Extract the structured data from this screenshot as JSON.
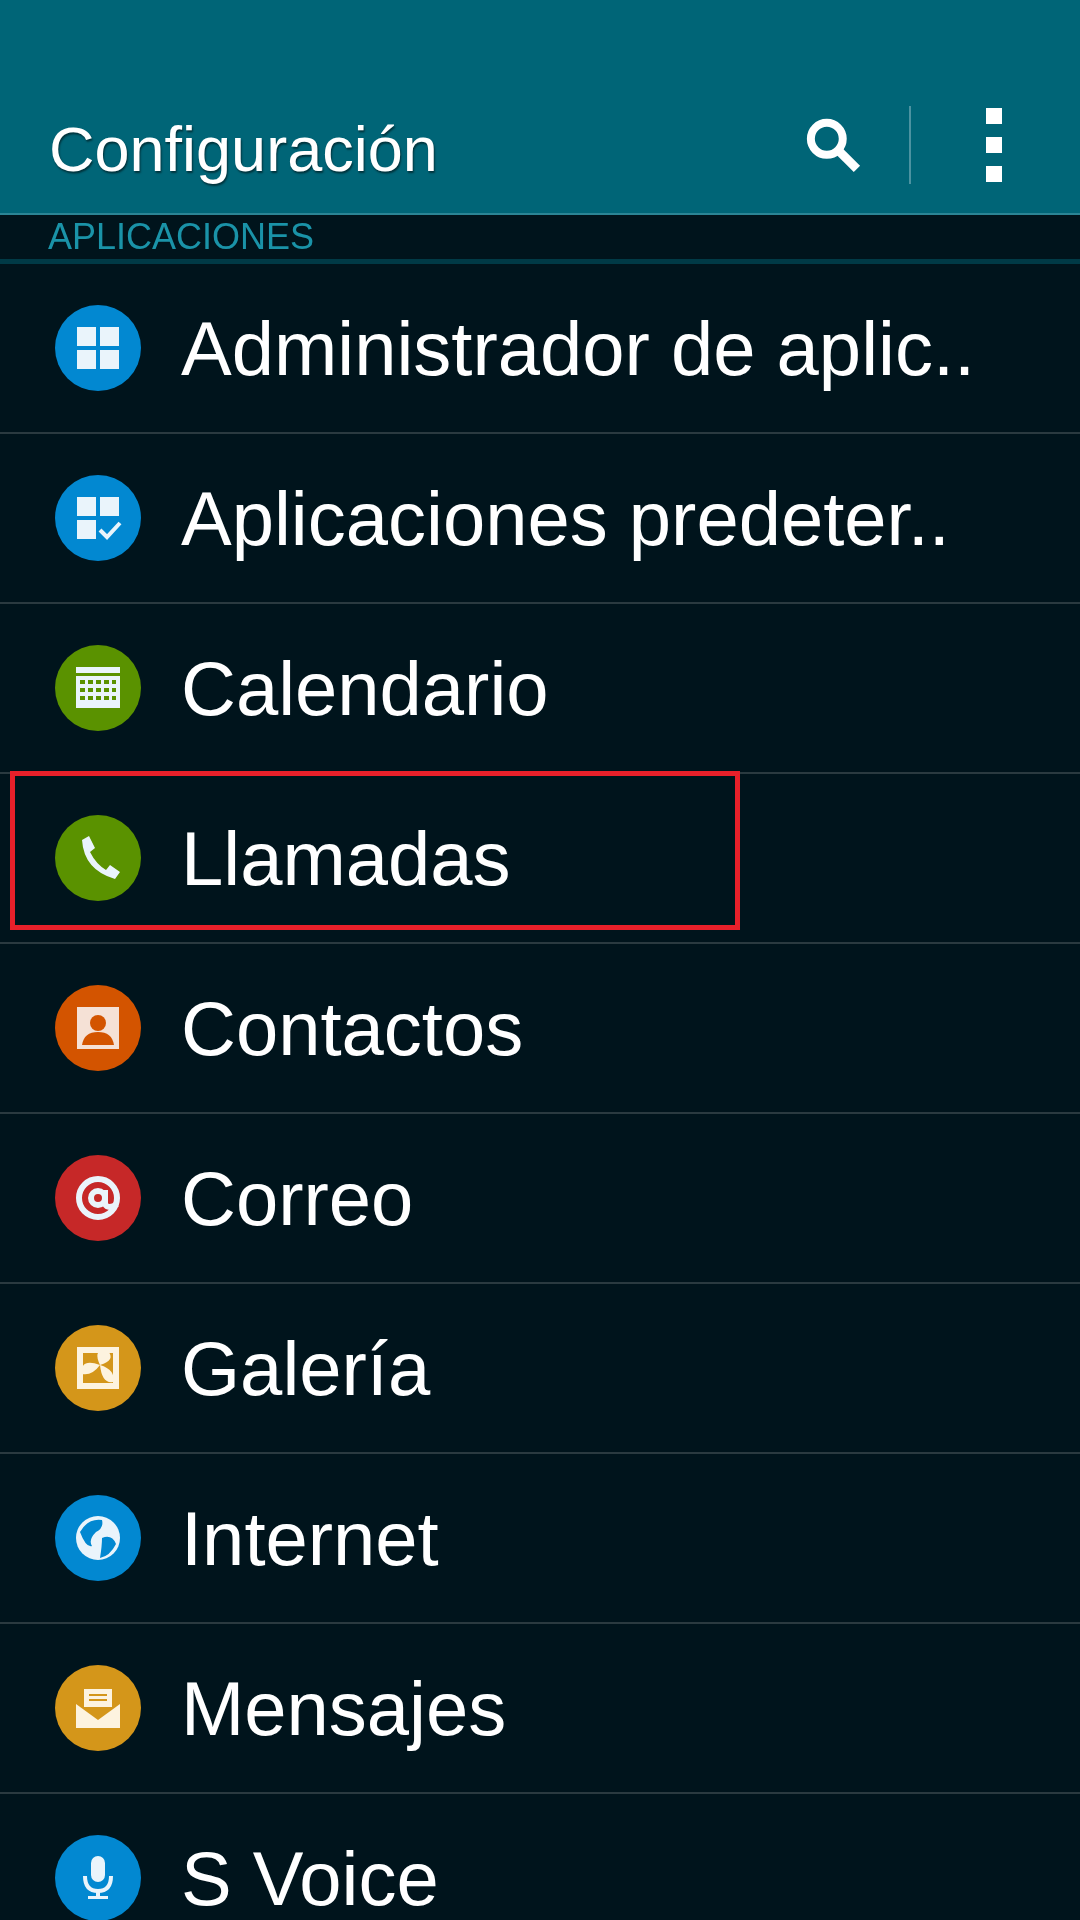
{
  "header": {
    "title": "Configuración"
  },
  "section": {
    "title": "APLICACIONES"
  },
  "items": [
    {
      "label": "Administrador de aplic..",
      "kind": "grid",
      "color": "#0288d1",
      "highlighted": false
    },
    {
      "label": "Aplicaciones predeter..",
      "kind": "grid-check",
      "color": "#0288d1",
      "highlighted": false
    },
    {
      "label": "Calendario",
      "kind": "calendar",
      "color": "#5a9200",
      "highlighted": false
    },
    {
      "label": "Llamadas",
      "kind": "phone",
      "color": "#5a9200",
      "highlighted": true
    },
    {
      "label": "Contactos",
      "kind": "contact",
      "color": "#d35400",
      "highlighted": false
    },
    {
      "label": "Correo",
      "kind": "at",
      "color": "#c62828",
      "highlighted": false
    },
    {
      "label": "Galería",
      "kind": "gallery",
      "color": "#d4961a",
      "highlighted": false
    },
    {
      "label": "Internet",
      "kind": "globe",
      "color": "#0288d1",
      "highlighted": false
    },
    {
      "label": "Mensajes",
      "kind": "envelope",
      "color": "#d4961a",
      "highlighted": false
    },
    {
      "label": "S Voice",
      "kind": "mic",
      "color": "#0288d1",
      "highlighted": false
    }
  ]
}
